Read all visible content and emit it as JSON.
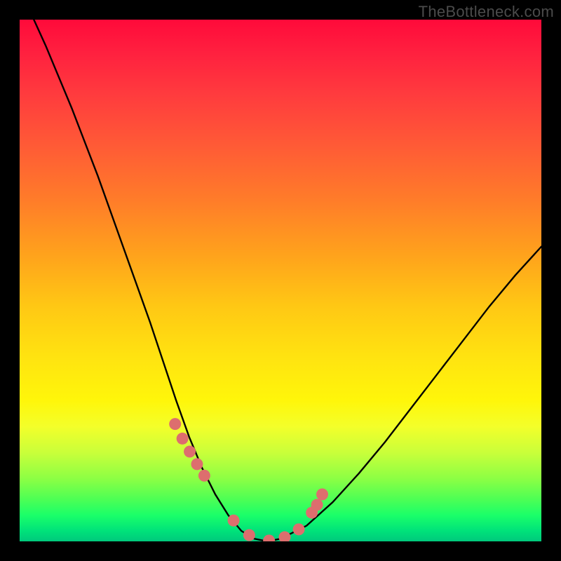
{
  "watermark": "TheBottleneck.com",
  "chart_data": {
    "type": "line",
    "title": "",
    "xlabel": "",
    "ylabel": "",
    "xlim": [
      0,
      1
    ],
    "ylim": [
      0,
      1
    ],
    "note": "Axes unlabeled; x and y given in normalized [0,1] coordinates matching the plot area (x right, y up).",
    "series": [
      {
        "name": "bottleneck-curve",
        "x": [
          0.0,
          0.05,
          0.1,
          0.15,
          0.2,
          0.25,
          0.3,
          0.325,
          0.35,
          0.375,
          0.4,
          0.425,
          0.45,
          0.475,
          0.5,
          0.55,
          0.6,
          0.65,
          0.7,
          0.75,
          0.8,
          0.85,
          0.9,
          0.95,
          1.0
        ],
        "y": [
          1.06,
          0.95,
          0.83,
          0.7,
          0.56,
          0.42,
          0.27,
          0.2,
          0.14,
          0.09,
          0.05,
          0.02,
          0.005,
          0.0,
          0.005,
          0.03,
          0.075,
          0.13,
          0.19,
          0.255,
          0.32,
          0.385,
          0.45,
          0.51,
          0.565
        ]
      },
      {
        "name": "marker-dots",
        "x": [
          0.298,
          0.312,
          0.326,
          0.34,
          0.354,
          0.41,
          0.44,
          0.478,
          0.508,
          0.535,
          0.56,
          0.57,
          0.58
        ],
        "y": [
          0.225,
          0.197,
          0.172,
          0.148,
          0.126,
          0.04,
          0.012,
          0.0015,
          0.008,
          0.023,
          0.055,
          0.07,
          0.09
        ]
      }
    ]
  }
}
